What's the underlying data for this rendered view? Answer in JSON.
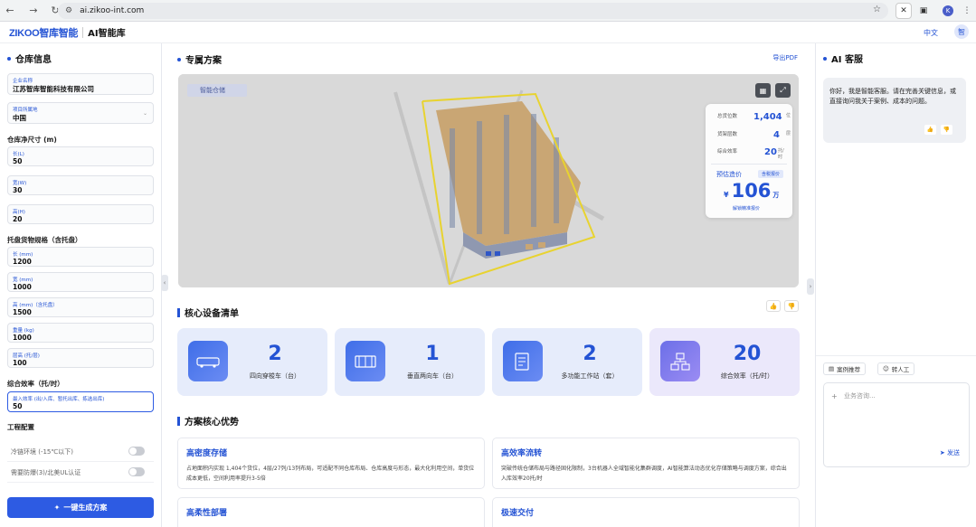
{
  "browser": {
    "url": "ai.zikoo-int.com",
    "avatar_initial": "K"
  },
  "app": {
    "logo": "ZIKOO智库智能",
    "product": "AI智能库",
    "lang": "中文",
    "user_initial": "智"
  },
  "left": {
    "title": "仓库信息",
    "company": {
      "label": "企业名称",
      "value": "江苏智库智能科技有限公司"
    },
    "country": {
      "label": "项目所属地",
      "value": "中国"
    },
    "size_title": "仓库净尺寸 (m)",
    "size": [
      {
        "label": "长(L)",
        "value": "50"
      },
      {
        "label": "宽(W)",
        "value": "30"
      },
      {
        "label": "高(H)",
        "value": "20"
      }
    ],
    "pallet_title": "托盘货物规格（含托盘）",
    "pallet": [
      {
        "label": "长 (mm)",
        "value": "1200"
      },
      {
        "label": "宽 (mm)",
        "value": "1000"
      },
      {
        "label": "高 (mm)（含托盘）",
        "value": "1500"
      },
      {
        "label": "重量 (kg)",
        "value": "1000"
      },
      {
        "label": "层高 (托/层)",
        "value": "100"
      }
    ],
    "efficiency_title": "综合效率（托/时）",
    "efficiency": {
      "label": "最入效率 (出/入库、暂托出库、拣选出库)",
      "value": "50"
    },
    "engineering_title": "工程配置",
    "toggles": [
      "冷链环境 (-15℃以下)",
      "需要防爆(3)/北美UL认证"
    ],
    "generate_label": "一键生成方案"
  },
  "center": {
    "title": "专属方案",
    "export_label": "导出PDF",
    "viewer_tag": "智能仓储",
    "stats": [
      {
        "label": "总货位数",
        "value": "1,404",
        "unit": "位"
      },
      {
        "label": "货架层数",
        "value": "4",
        "unit": "层"
      },
      {
        "label": "综合效率",
        "value": "20",
        "unit": "托/时"
      }
    ],
    "price_label": "预估造价",
    "price_badge": "含税报价",
    "price_currency": "¥",
    "price_value": "106",
    "price_unit": "万",
    "price_link": "解锁精准报价",
    "equip_title": "核心设备清单",
    "equipment": [
      {
        "value": "2",
        "label": "四向穿梭车（台）",
        "icon": "shuttle-icon"
      },
      {
        "value": "1",
        "label": "垂直两向车（台）",
        "icon": "lift-icon"
      },
      {
        "value": "2",
        "label": "多功能工作站（套）",
        "icon": "workstation-icon"
      },
      {
        "value": "20",
        "label": "综合效率（托/时）",
        "icon": "network-icon"
      }
    ],
    "adv_title": "方案核心优势",
    "advantages": [
      {
        "title": "高密度存储",
        "desc": "占地面积内实现 1,404个货位，4层/27列/13列布局，可适配不同仓库布局、仓库高度与形态，最大化利用空间，单货位成本更低，空间利用率提升3-5倍"
      },
      {
        "title": "高效率流转",
        "desc": "突破传统仓储布局与路径固化限制，3台机器人全域智能化集群调度，AI智能算法动态优化存储策略与调度方案，综合出入库效率20托/时"
      },
      {
        "title": "高柔性部署",
        "desc": ""
      },
      {
        "title": "极速交付",
        "desc": ""
      }
    ]
  },
  "right": {
    "title": "AI 客服",
    "greeting": "你好，我是智能客服。请在完善关键信息，或直接询问我关于案例、成本的问题。",
    "case_btn": "案例推荐",
    "human_btn": "转人工",
    "input_placeholder": "业务咨询...",
    "send_label": "发送"
  }
}
